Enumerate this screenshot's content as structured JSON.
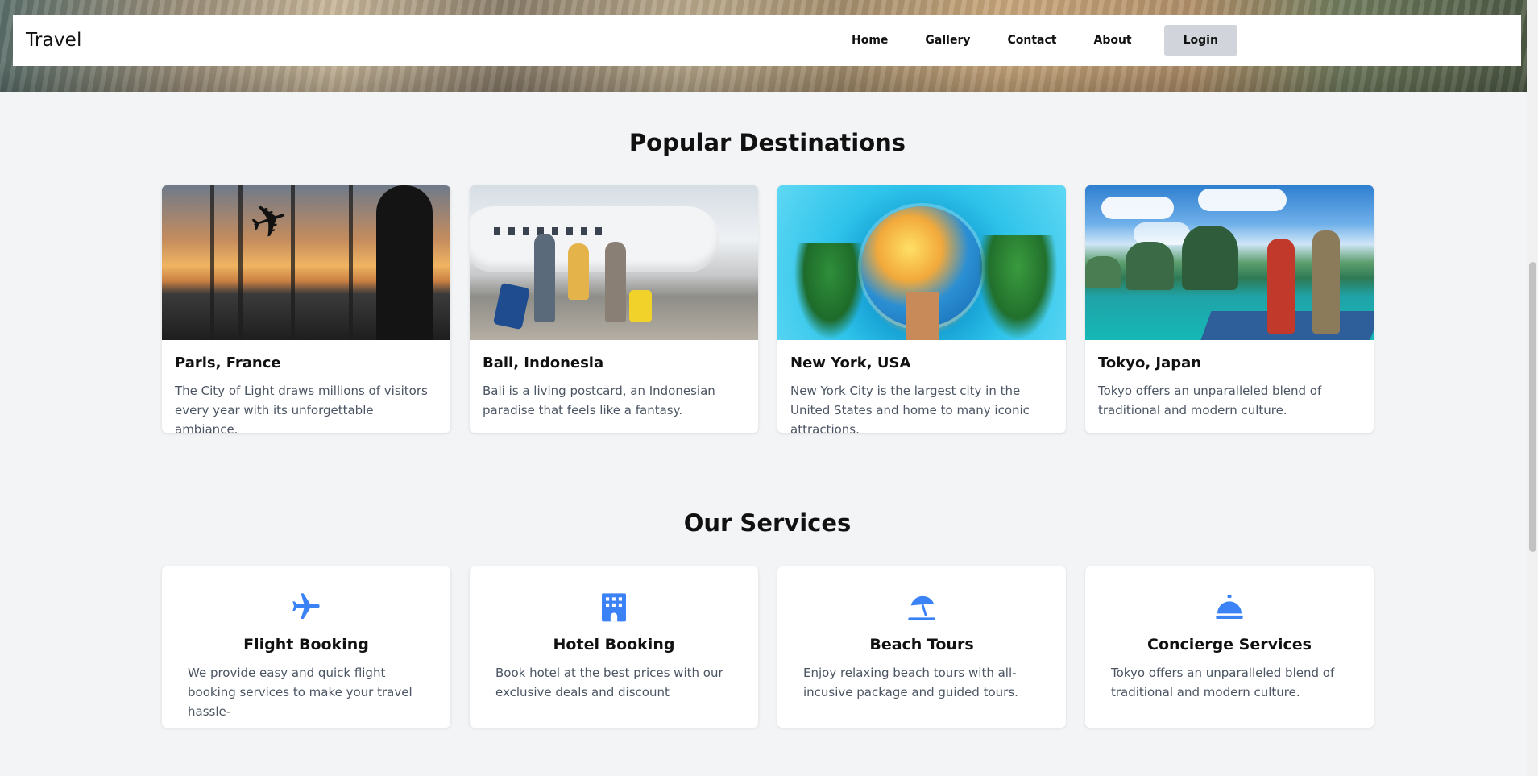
{
  "brand": "Travel",
  "nav": {
    "home": "Home",
    "gallery": "Gallery",
    "contact": "Contact",
    "about": "About",
    "login": "Login"
  },
  "destinations": {
    "title": "Popular Destinations",
    "items": [
      {
        "title": "Paris, France",
        "desc": "The City of Light draws millions of visitors every year with its unforgettable ambiance.",
        "image": "airport-window-traveler-silhouette"
      },
      {
        "title": "Bali, Indonesia",
        "desc": "Bali is a living postcard, an Indonesian paradise that feels like a fantasy.",
        "image": "family-walking-to-airplane"
      },
      {
        "title": "New York, USA",
        "desc": "New York City is the largest city in the United States and home to many iconic attractions.",
        "image": "illustrated-globe-with-landmarks"
      },
      {
        "title": "Tokyo, Japan",
        "desc": "Tokyo offers an unparalleled blend of traditional and modern culture.",
        "image": "travelers-waving-at-island-bay"
      }
    ]
  },
  "services": {
    "title": "Our Services",
    "items": [
      {
        "title": "Flight Booking",
        "desc": "We provide easy and quick flight booking services to make your travel hassle-",
        "icon": "airplane-icon"
      },
      {
        "title": "Hotel Booking",
        "desc": "Book hotel at the best prices with our exclusive deals and discount",
        "icon": "hotel-icon"
      },
      {
        "title": "Beach Tours",
        "desc": "Enjoy relaxing beach tours with all-incusive package and guided tours.",
        "icon": "beach-umbrella-icon"
      },
      {
        "title": "Concierge Services",
        "desc": "Tokyo offers an unparalleled blend of traditional and modern culture.",
        "icon": "concierge-bell-icon"
      }
    ]
  },
  "colors": {
    "accent": "#3b82f6",
    "background": "#f3f4f6",
    "login_bg": "#d1d5db",
    "body_text": "#4b5563"
  }
}
